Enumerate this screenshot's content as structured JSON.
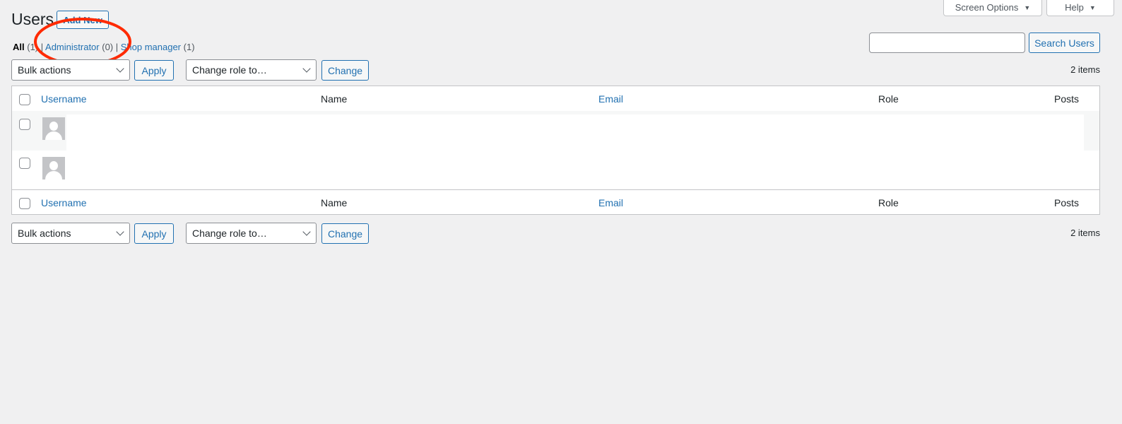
{
  "header": {
    "title": "Users",
    "add_new": "Add New",
    "screen_options": "Screen Options",
    "help": "Help"
  },
  "filters": [
    {
      "label": "All",
      "count": "(1)"
    },
    {
      "label": "Administrator",
      "count": "(0)"
    },
    {
      "label": "Shop manager",
      "count": "(1)"
    }
  ],
  "search": {
    "value": "",
    "button": "Search Users"
  },
  "tablenav": {
    "bulk_actions": "Bulk actions",
    "apply": "Apply",
    "change_role": "Change role to…",
    "change": "Change",
    "items": "2 items"
  },
  "table": {
    "columns": [
      "Username",
      "Name",
      "Email",
      "Role",
      "Posts"
    ],
    "rows": [
      {
        "username": "",
        "name": "",
        "email": "",
        "role": "",
        "posts": ""
      },
      {
        "username": "",
        "name": "",
        "email": "",
        "role": "",
        "posts": ""
      }
    ]
  },
  "annotation": {
    "color": "#ff2a00",
    "target": "Administrator (0)"
  }
}
